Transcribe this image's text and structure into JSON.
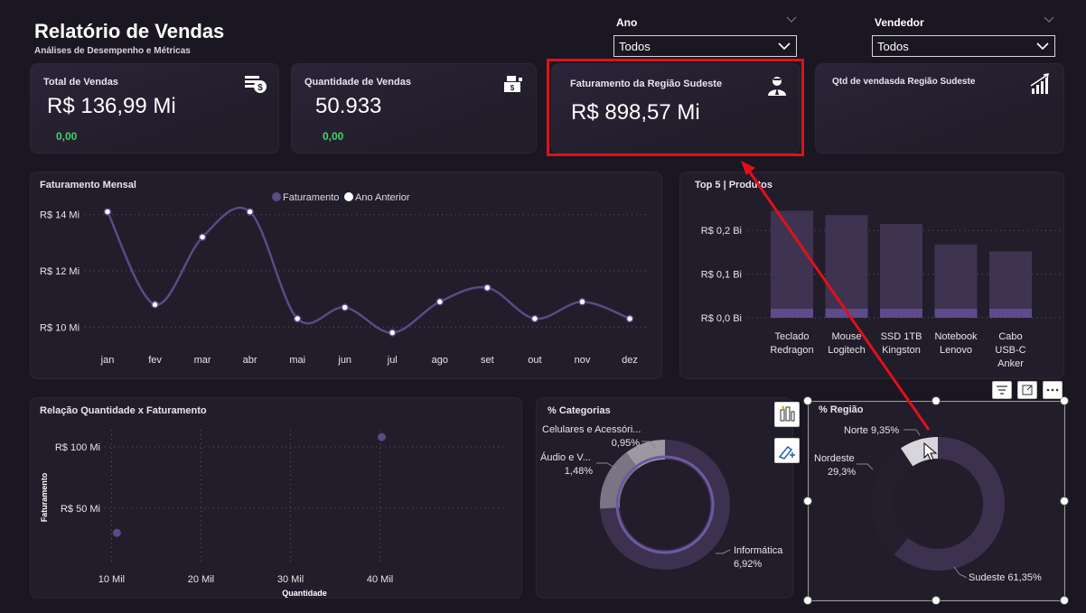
{
  "header": {
    "title": "Relatório de Vendas",
    "subtitle": "Análises de Desempenho e Métricas"
  },
  "filters": {
    "ano": {
      "label": "Ano",
      "value": "Todos"
    },
    "vendedor": {
      "label": "Vendedor",
      "value": "Todos"
    }
  },
  "kpis": [
    {
      "title": "Total de Vendas",
      "value": "R$ 136,99 Mi",
      "delta": "0,00",
      "icon": "money-stack-icon"
    },
    {
      "title": "Quantidade de Vendas",
      "value": "50.933",
      "delta": "0,00",
      "icon": "cash-register-icon"
    },
    {
      "title": "Faturamento da Região Sudeste",
      "value": "R$ 898,57 Mi",
      "icon": "salesperson-icon"
    },
    {
      "title": "Qtd de vendasda Região Sudeste",
      "value": "",
      "icon": "growth-chart-icon"
    }
  ],
  "colors": {
    "series": "#5b4a86",
    "bar": "#3e3452",
    "bar_base": "#5e4a8c",
    "accent_red": "#e0101a",
    "positive": "#3fd36b"
  },
  "chart_data": [
    {
      "type": "line",
      "title": "Faturamento Mensal",
      "categories": [
        "jan",
        "fev",
        "mar",
        "abr",
        "mai",
        "jun",
        "jul",
        "ago",
        "set",
        "out",
        "nov",
        "dez"
      ],
      "series": [
        {
          "name": "Faturamento",
          "values": [
            14.1,
            10.8,
            13.2,
            14.1,
            10.3,
            10.7,
            9.8,
            10.9,
            11.4,
            10.3,
            10.9,
            10.3
          ]
        }
      ],
      "legend": [
        "Faturamento",
        "Ano Anterior"
      ],
      "legend_position": "top-center",
      "yticks": [
        "R$ 14 Mi",
        "R$ 12 Mi",
        "R$ 10 Mi"
      ],
      "ytick_values": [
        14,
        12,
        10
      ],
      "ylim": [
        9.4,
        14.6
      ],
      "grid": true
    },
    {
      "type": "bar",
      "title": "Top 5 | Produtos",
      "categories": [
        "Teclado Redragon",
        "Mouse Logitech",
        "SSD 1TB Kingston",
        "Notebook Lenovo",
        "Cabo USB-C Anker"
      ],
      "values": [
        0.245,
        0.235,
        0.215,
        0.168,
        0.152
      ],
      "yticks": [
        "R$ 0,2 Bi",
        "R$ 0,1 Bi",
        "R$ 0,0 Bi"
      ],
      "ytick_values": [
        0.2,
        0.1,
        0.0
      ],
      "ylim": [
        0,
        0.25
      ],
      "grid": true
    },
    {
      "type": "scatter",
      "title": "Relação Quantidade x Faturamento",
      "xlabel": "Quantidade",
      "ylabel": "Faturamento",
      "xticks": [
        "10 Mil",
        "20 Mil",
        "30 Mil",
        "40 Mil"
      ],
      "xtick_values": [
        10,
        20,
        30,
        40
      ],
      "yticks": [
        "R$ 100 Mi",
        "R$ 50 Mi"
      ],
      "ytick_values": [
        100,
        50
      ],
      "xlim": [
        4,
        56
      ],
      "ylim": [
        0,
        125
      ],
      "points": [
        {
          "x": 10.6,
          "y": 30
        },
        {
          "x": 40.2,
          "y": 108
        }
      ],
      "grid": true
    },
    {
      "type": "pie",
      "title": "% Categorias",
      "slices": [
        {
          "label": "Informática",
          "value": 6.92,
          "value_label": "6,92%"
        },
        {
          "label": "Áudio e V...",
          "value": 1.48,
          "value_label": "1,48%"
        },
        {
          "label": "Celulares e Acessóri...",
          "value": 0.95,
          "value_label": "0,95%"
        }
      ]
    },
    {
      "type": "pie",
      "title": "% Região",
      "slices": [
        {
          "label": "Sudeste",
          "value": 61.35,
          "value_label": "Sudeste 61,35%"
        },
        {
          "label": "Nordeste",
          "value": 29.3,
          "value_label": "29,3%"
        },
        {
          "label": "Norte",
          "value": 9.35,
          "value_label": "Norte 9,35%"
        }
      ]
    }
  ]
}
